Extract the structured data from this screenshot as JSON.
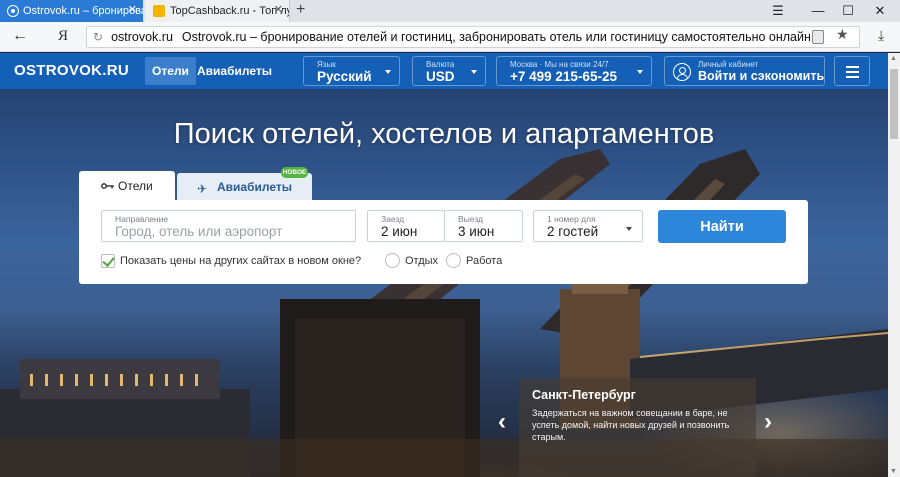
{
  "browser": {
    "tabs": [
      {
        "title": "Ostrovok.ru – бронирова",
        "active": true
      },
      {
        "title": "TopCashback.ru - Топ лучши",
        "active": false
      }
    ],
    "new_tab_symbol": "+",
    "window_controls": [
      "☰",
      "—",
      "☐",
      "✕"
    ],
    "nav_back": "←",
    "yandex_logo": "Я",
    "address": {
      "domain": "ostrovok.ru",
      "page_title": "Ostrovok.ru – бронирование отелей и гостиниц, забронировать отель или гостиницу самостоятельно онлайн"
    }
  },
  "site_header": {
    "logo": "OSTROVOK.RU",
    "nav": [
      "Отели",
      "Авиабилеты"
    ],
    "language": {
      "label": "Язык",
      "value": "Русский"
    },
    "currency": {
      "label": "Валюта",
      "value": "USD"
    },
    "support": {
      "label": "Москва  ·  Мы на связи 24/7",
      "value": "+7 499 215-65-25"
    },
    "account": {
      "label": "Личный кабинет",
      "value": "Войти и сэкономить"
    }
  },
  "hero": {
    "title": "Поиск отелей, хостелов и апартаментов"
  },
  "search": {
    "tab_hotels": "Отели",
    "tab_air": "Авиабилеты",
    "new_badge": "НОВОЕ",
    "destination": {
      "label": "Направление",
      "placeholder": "Город, отель или аэропорт"
    },
    "checkin": {
      "label": "Заезд",
      "value": "2 июн"
    },
    "checkout": {
      "label": "Выезд",
      "value": "3 июн"
    },
    "guests": {
      "label": "1 номер для",
      "value": "2 гостей"
    },
    "submit": "Найти",
    "show_prices_checkbox": "Показать цены на других сайтах в новом окне?",
    "show_prices_checked": true,
    "purpose_options": [
      "Отдых",
      "Работа"
    ]
  },
  "caption": {
    "title": "Санкт-Петербург",
    "text": "Задержаться на важном совещании в баре, не успеть домой, найти новых друзей и позвонить старым."
  },
  "colors": {
    "header_blue": "#1460b6",
    "button_blue": "#2d86da",
    "badge_green": "#54b541"
  }
}
